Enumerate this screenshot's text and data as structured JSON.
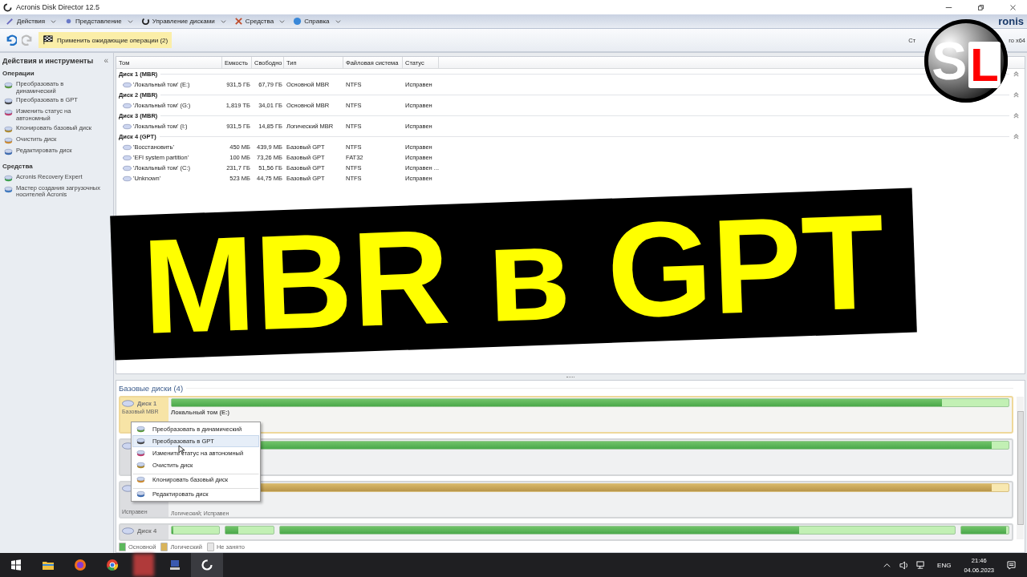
{
  "window": {
    "title": "Acronis Disk Director 12.5"
  },
  "menu": [
    {
      "label": "Действия"
    },
    {
      "label": "Представление"
    },
    {
      "label": "Управление дисками"
    },
    {
      "label": "Средства"
    },
    {
      "label": "Справка"
    }
  ],
  "brand_fragment": "ronis",
  "toolbar": {
    "undo": {
      "disabled": false
    },
    "redo": {
      "disabled": true
    },
    "apply_button": "Применить ожидающие операции (2)",
    "right_text_start": "Ст",
    "right_text_end": "ro x64"
  },
  "sidebar": {
    "title": "Действия и инструменты",
    "collapse_glyph": "«",
    "sections": [
      {
        "title": "Операции",
        "items": [
          "Преобразовать в динамический",
          "Преобразовать в GPT",
          "Изменить статус на автономный",
          "Клонировать базовый диск",
          "Очистить диск",
          "Редактировать диск"
        ]
      },
      {
        "title": "Средства",
        "items": [
          "Acronis Recovery Expert",
          "Мастер создания загрузочных носителей Acronis"
        ]
      }
    ]
  },
  "table": {
    "columns": [
      "Том",
      "Емкость",
      "Свободно",
      "Тип",
      "Файловая система",
      "Статус"
    ],
    "groups": [
      {
        "title": "Диск 1 (MBR)",
        "expanded": true,
        "rows": [
          [
            "'Локальный том' (E:)",
            "931,5 ГБ",
            "67,79 ГБ",
            "Основной MBR",
            "NTFS",
            "Исправен"
          ]
        ]
      },
      {
        "title": "Диск 2 (MBR)",
        "expanded": true,
        "rows": [
          [
            "'Локальный том' (G:)",
            "1,819 ТБ",
            "34,01 ГБ",
            "Основной MBR",
            "NTFS",
            "Исправен"
          ]
        ]
      },
      {
        "title": "Диск 3 (MBR)",
        "expanded": true,
        "rows": [
          [
            "'Локальный том' (I:)",
            "931,5 ГБ",
            "14,85 ГБ",
            "Логический MBR",
            "NTFS",
            "Исправен"
          ]
        ]
      },
      {
        "title": "Диск 4 (GPT)",
        "expanded": true,
        "rows": [
          [
            "'Восстановить'",
            "450 МБ",
            "439,9 МБ",
            "Базовый GPT",
            "NTFS",
            "Исправен"
          ],
          [
            "'EFI system partition'",
            "100 МБ",
            "73,26 МБ",
            "Базовый GPT",
            "FAT32",
            "Исправен"
          ],
          [
            "'Локальный том' (C:)",
            "231,7 ГБ",
            "51,56 ГБ",
            "Базовый GPT",
            "NTFS",
            "Исправен ..."
          ],
          [
            "'Unknown'",
            "523 МБ",
            "44,75 МБ",
            "Базовый GPT",
            "NTFS",
            "Исправен"
          ]
        ]
      }
    ]
  },
  "banner": {
    "text": "MBR в GPT"
  },
  "logo": {
    "letters": [
      "S",
      "L"
    ]
  },
  "disk_map": {
    "title": "Базовые диски (4)",
    "disks": [
      {
        "name": "Диск 1",
        "selected": true,
        "info": [
          "Базовый MBR"
        ],
        "partition_title": "Локальный том (E:)",
        "segments": [
          {
            "kind": "primary",
            "level": 0.92
          }
        ]
      },
      {
        "selected": false,
        "segments": [
          {
            "kind": "primary",
            "level": 0.98
          }
        ]
      },
      {
        "selected": false,
        "status": "Исправен",
        "partition_lines": [
          "Логический; Исправен"
        ],
        "segments": [
          {
            "kind": "logical",
            "level": 0.98
          }
        ]
      },
      {
        "name": "Диск 4",
        "selected": false,
        "segments": [
          {
            "kind": "primary",
            "level": 0.03
          },
          {
            "kind": "primary",
            "level": 0.27
          },
          {
            "kind": "primary",
            "level": 0.77
          },
          {
            "kind": "primary",
            "level": 0.95
          }
        ]
      }
    ],
    "legend": [
      {
        "label": "Основной",
        "color": "#5cb85c"
      },
      {
        "label": "Логический",
        "color": "#d9b45a"
      },
      {
        "label": "Не занято",
        "color": "#e6e6e6"
      }
    ]
  },
  "context_menu": {
    "items": [
      {
        "label": "Преобразовать в динамический",
        "selected": false,
        "separator_before": false
      },
      {
        "label": "Преобразовать в GPT",
        "selected": true,
        "separator_before": false
      },
      {
        "label": "Изменить статус на автономный",
        "selected": false,
        "separator_before": false
      },
      {
        "label": "Очистить диск",
        "selected": false,
        "separator_before": false
      },
      {
        "label": "Клонировать базовый диск",
        "selected": false,
        "separator_before": true
      },
      {
        "label": "Редактировать диск",
        "selected": false,
        "separator_before": true
      }
    ]
  },
  "taskbar": {
    "language": "ENG",
    "time": "21:46",
    "date": "04.06.2023"
  }
}
